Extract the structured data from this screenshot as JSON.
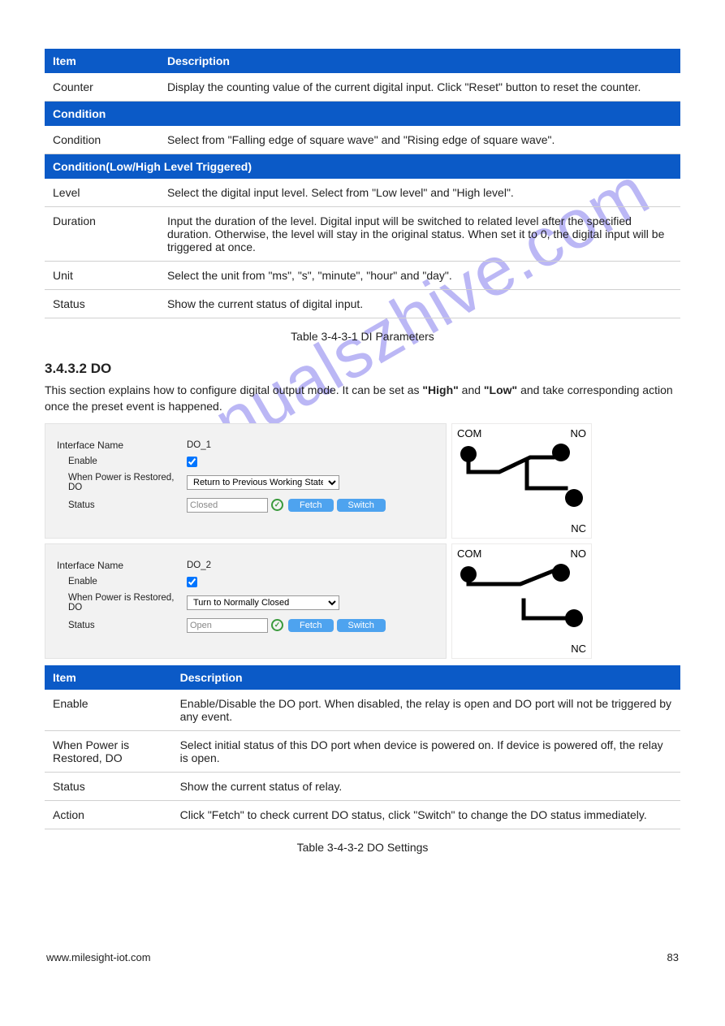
{
  "watermark": "manualszhive.com",
  "table1": {
    "header": {
      "c1": "Item",
      "c2": "Description"
    },
    "r1": {
      "c1": "Counter",
      "c2": "Display the counting value of the current digital input. Click \"Reset\" button to reset the counter."
    },
    "subhead1": "Condition",
    "r2": {
      "c1": "Condition",
      "c2": "Select from \"Falling edge of square wave\" and \"Rising edge of square wave\"."
    },
    "subhead2": "Condition(Low/High Level Triggered)",
    "r3": {
      "c1": "Level",
      "c2": "Select the digital input level. Select from \"Low level\" and \"High level\"."
    },
    "r4": {
      "c1": "Duration",
      "c2": "Input the duration of the level. Digital input will be switched to related level after the specified duration. Otherwise, the level will stay in the original status. When set it to 0, the digital input will be triggered at once."
    },
    "r5": {
      "c1": "Unit",
      "c2": "Select the unit from \"ms\", \"s\", \"minute\", \"hour\" and \"day\"."
    },
    "r6": {
      "c1": "Status",
      "c2": "Show the current status of digital input."
    }
  },
  "table1_caption": "Table 3-4-3-1 DI Parameters",
  "section_title": "3.4.3.2 DO",
  "section_desc_pre": "This section explains how to configure digital output mode. It can be set as ",
  "section_desc_bold": "\"High\"",
  "section_desc_mid": " and ",
  "section_desc_bold2": "\"Low\"",
  "section_desc_post": " and take corresponding action once the preset event is happened.",
  "panels": [
    {
      "iface_label": "Interface Name",
      "iface_value": "DO_1",
      "enable_label": "Enable",
      "enable": true,
      "power_label": "When Power is Restored, DO",
      "power_value": "Return to Previous Working State",
      "status_label": "Status",
      "status_value": "Closed",
      "fetch": "Fetch",
      "switch": "Switch",
      "diag": {
        "com": "COM",
        "no": "NO",
        "nc": "NC",
        "variant": "closed"
      }
    },
    {
      "iface_label": "Interface Name",
      "iface_value": "DO_2",
      "enable_label": "Enable",
      "enable": true,
      "power_label": "When Power is Restored, DO",
      "power_value": "Turn to Normally Closed",
      "status_label": "Status",
      "status_value": "Open",
      "fetch": "Fetch",
      "switch": "Switch",
      "diag": {
        "com": "COM",
        "no": "NO",
        "nc": "NC",
        "variant": "open"
      }
    }
  ],
  "table2": {
    "header": {
      "c1": "Item",
      "c2": "Description"
    },
    "r1": {
      "c1": "Enable",
      "c2": "Enable/Disable the DO port. When disabled, the relay is open and DO port will not be triggered by any event."
    },
    "r2": {
      "c1": "When Power is Restored, DO",
      "c2": "Select initial status of this DO port when device is powered on. If device is powered off, the relay is open."
    },
    "r3": {
      "c1": "Status",
      "c2": "Show the current status of relay."
    },
    "r4": {
      "c1": "Action",
      "c2": "Click \"Fetch\" to check current DO status, click \"Switch\" to change the DO status immediately."
    }
  },
  "table2_caption": "Table 3-4-3-2 DO Settings",
  "footer": {
    "left": "www.milesight-iot.com",
    "right": "83"
  }
}
